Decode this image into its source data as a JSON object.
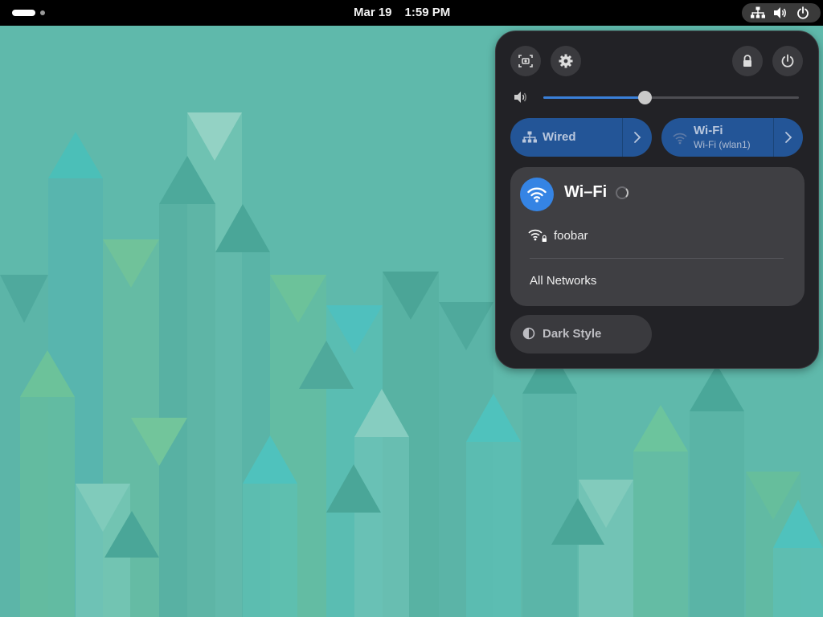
{
  "topbar": {
    "date": "Mar 19",
    "time": "1:59 PM",
    "status_icons": [
      "wired-network-icon",
      "volume-icon",
      "power-icon"
    ]
  },
  "quick_settings": {
    "buttons": [
      "screenshot-icon",
      "settings-icon",
      "lock-icon",
      "power-icon"
    ],
    "volume": {
      "icon": "volume-icon",
      "level": 0.4
    },
    "toggles": {
      "wired": {
        "label": "Wired",
        "icon": "wired-network-icon"
      },
      "wifi": {
        "label": "Wi-Fi",
        "subtitle": "Wi-Fi (wlan1)",
        "icon": "wifi-icon"
      }
    },
    "wifi_menu": {
      "title": "Wi–Fi",
      "networks": [
        {
          "name": "foobar",
          "secured": true
        }
      ],
      "all_networks_label": "All Networks"
    },
    "dark_style": {
      "label": "Dark Style",
      "icon": "dark-style-icon"
    }
  },
  "colors": {
    "accent": "#3584e4",
    "toggle_active": "#235597",
    "panel_bg": "#222226",
    "wallpaper_base": "#5fb9ab"
  }
}
